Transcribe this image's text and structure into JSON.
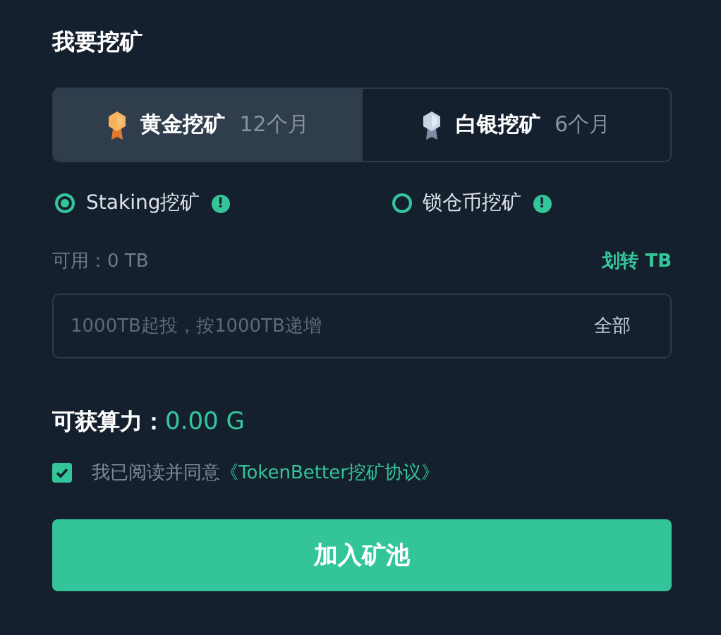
{
  "title": "我要挖矿",
  "plans": [
    {
      "kind": "gold",
      "name": "黄金挖矿",
      "term": "12个月",
      "selected": true
    },
    {
      "kind": "silver",
      "name": "白银挖矿",
      "term": "6个月",
      "selected": false
    }
  ],
  "modes": [
    {
      "label": "Staking挖矿",
      "info": "!",
      "selected": true
    },
    {
      "label": "锁仓币挖矿",
      "info": "!",
      "selected": false
    }
  ],
  "available": {
    "label": "可用：0 TB",
    "transfer_link": "划转 TB"
  },
  "amount_field": {
    "placeholder": "1000TB起投，按1000TB递增",
    "all_button": "全部"
  },
  "power": {
    "label": "可获算力：",
    "value": "0.00 G"
  },
  "agreement": {
    "checked": true,
    "text": "我已阅读并同意",
    "link": "《TokenBetter挖矿协议》"
  },
  "submit_button": "加入矿池"
}
